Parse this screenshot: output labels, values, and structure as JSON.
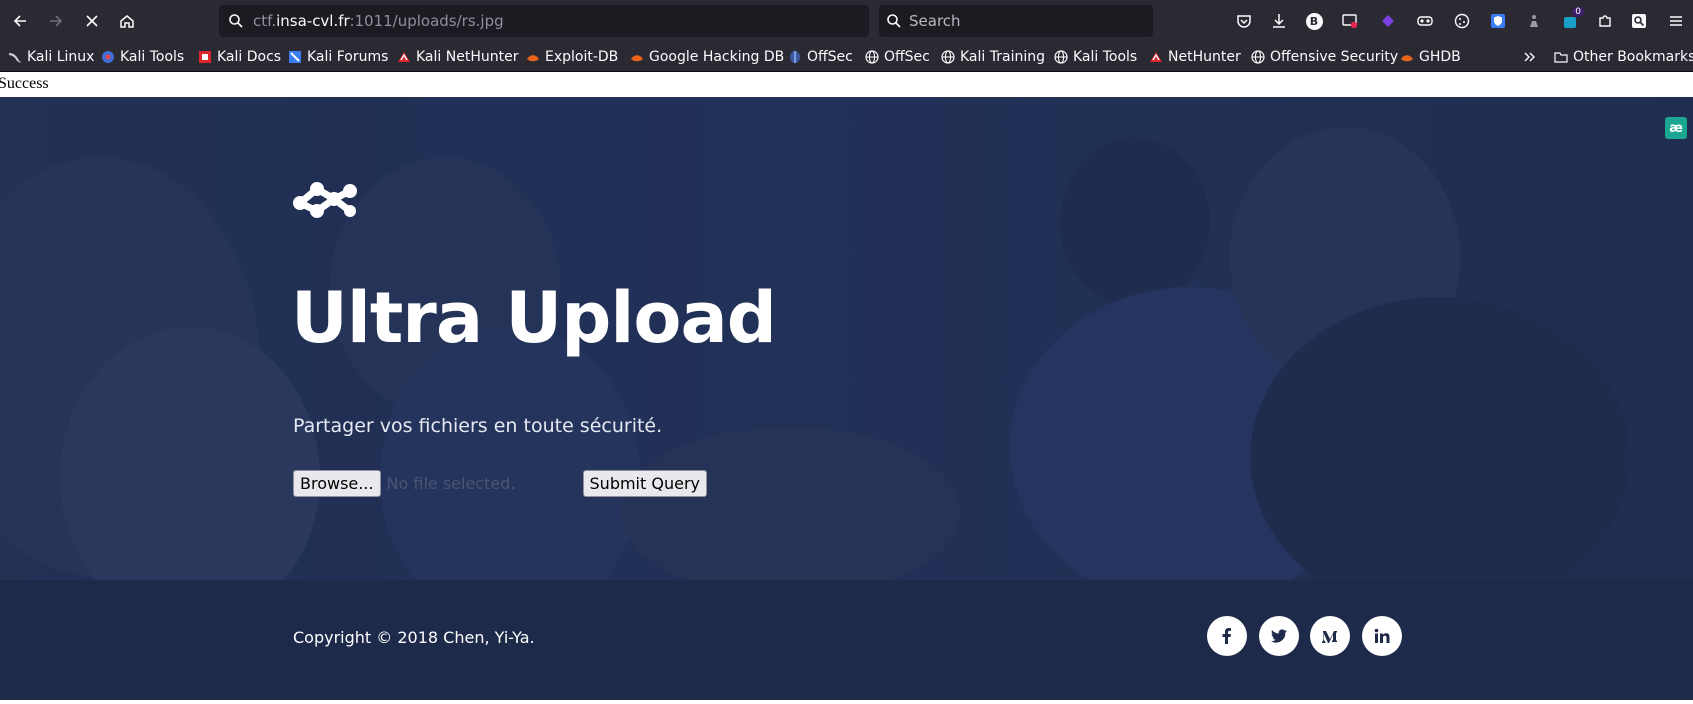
{
  "browser": {
    "url_prefix": "ctf.",
    "url_host": "insa-cvl.fr",
    "url_suffix": ":1011/uploads/rs.jpg",
    "search_placeholder": "Search",
    "extension_badge_count": "0",
    "extension_b_label": "B"
  },
  "bookmarks": [
    {
      "label": "Kali Linux",
      "icon": "kali-dragon-icon"
    },
    {
      "label": "Kali Tools",
      "icon": "kali-tools-icon"
    },
    {
      "label": "Kali Docs",
      "icon": "kali-docs-icon"
    },
    {
      "label": "Kali Forums",
      "icon": "kali-forums-icon"
    },
    {
      "label": "Kali NetHunter",
      "icon": "nethunter-icon"
    },
    {
      "label": "Exploit-DB",
      "icon": "exploitdb-icon"
    },
    {
      "label": "Google Hacking DB",
      "icon": "ghdb-icon"
    },
    {
      "label": "OffSec",
      "icon": "offsec-icon"
    },
    {
      "label": "OffSec",
      "icon": "globe-icon"
    },
    {
      "label": "Kali Training",
      "icon": "globe-icon"
    },
    {
      "label": "Kali Tools",
      "icon": "globe-icon"
    },
    {
      "label": "NetHunter",
      "icon": "nethunter-icon"
    },
    {
      "label": "Offensive Security",
      "icon": "globe-icon"
    },
    {
      "label": "GHDB",
      "icon": "ghdb-icon"
    }
  ],
  "other_bookmarks_label": "Other Bookmarks",
  "page": {
    "status_text": "Success",
    "title": "Ultra Upload",
    "subtitle": "Partager vos fichiers en toute sécurité.",
    "browse_label": "Browse...",
    "no_file_label": "No file selected.",
    "submit_label": "Submit Query",
    "copyright": "Copyright © 2018 Chen, Yi-Ya.",
    "ae_badge": "æ",
    "social_icons": [
      "facebook-icon",
      "twitter-icon",
      "medium-icon",
      "linkedin-icon"
    ]
  },
  "colors": {
    "chrome_bg": "#2b2a33",
    "hero_bg": "#243560",
    "footer_bg": "#1e2a4a",
    "badge_teal": "#1aa68f"
  }
}
